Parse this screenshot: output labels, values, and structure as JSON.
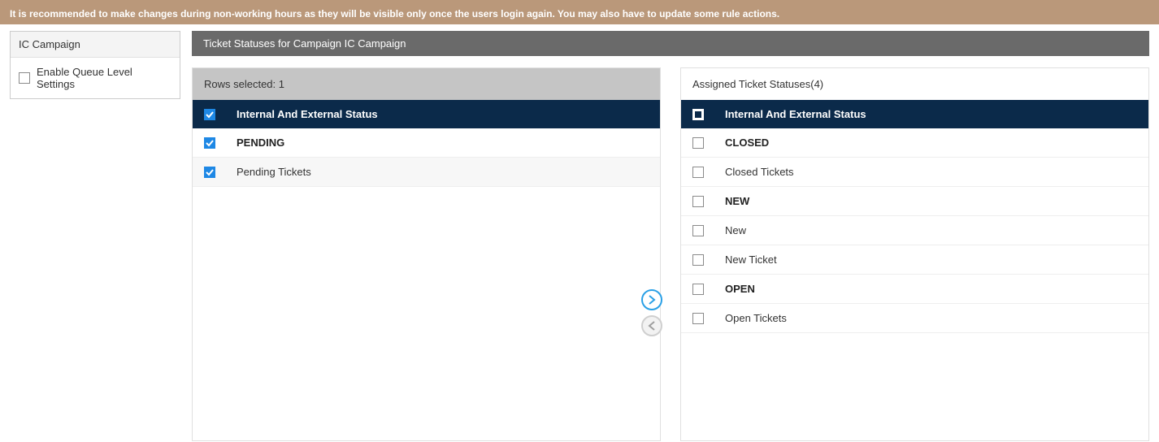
{
  "banner": {
    "message": "It is recommended to make changes during non-working hours as they will be visible only once the users login again. You may also have to update some rule actions."
  },
  "sidebar": {
    "title": "IC Campaign",
    "enable_queue_label": "Enable Queue Level Settings",
    "enable_queue_checked": false
  },
  "main": {
    "title": "Ticket Statuses for Campaign IC Campaign"
  },
  "left_panel": {
    "subheader": "Rows selected: 1",
    "column_header": "Internal And External Status",
    "header_checked": true,
    "rows": [
      {
        "label": "PENDING",
        "bold": true,
        "checked": true,
        "alt": false
      },
      {
        "label": "Pending Tickets",
        "bold": false,
        "checked": true,
        "alt": true
      }
    ]
  },
  "right_panel": {
    "subheader": "Assigned Ticket Statuses(4)",
    "column_header": "Internal And External Status",
    "header_indeterminate": true,
    "rows": [
      {
        "label": "CLOSED",
        "bold": true,
        "checked": false,
        "alt": false
      },
      {
        "label": "Closed Tickets",
        "bold": false,
        "checked": false,
        "alt": false
      },
      {
        "label": "NEW",
        "bold": true,
        "checked": false,
        "alt": false
      },
      {
        "label": "New",
        "bold": false,
        "checked": false,
        "alt": false
      },
      {
        "label": "New Ticket",
        "bold": false,
        "checked": false,
        "alt": false
      },
      {
        "label": "OPEN",
        "bold": true,
        "checked": false,
        "alt": false
      },
      {
        "label": "Open Tickets",
        "bold": false,
        "checked": false,
        "alt": false
      }
    ]
  }
}
